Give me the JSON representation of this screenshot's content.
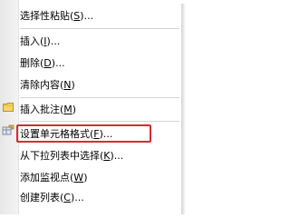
{
  "menu": {
    "items": [
      {
        "prefix": "选择性粘贴(",
        "key": "S",
        "suffix": ")..."
      },
      {
        "prefix": "插入(",
        "key": "I",
        "suffix": ")..."
      },
      {
        "prefix": "删除(",
        "key": "D",
        "suffix": ")..."
      },
      {
        "prefix": "清除内容(",
        "key": "N",
        "suffix": ")"
      },
      {
        "prefix": "插入批注(",
        "key": "M",
        "suffix": ")"
      },
      {
        "prefix": "设置单元格格式(",
        "key": "F",
        "suffix": ")..."
      },
      {
        "prefix": "从下拉列表中选择(",
        "key": "K",
        "suffix": ")..."
      },
      {
        "prefix": "添加监视点(",
        "key": "W",
        "suffix": ")"
      },
      {
        "prefix": "创建列表(",
        "key": "C",
        "suffix": ")..."
      }
    ]
  },
  "highlight": {
    "color": "#d52b34"
  },
  "icons": {
    "comment": "comment-note-icon",
    "format": "format-cells-icon"
  }
}
